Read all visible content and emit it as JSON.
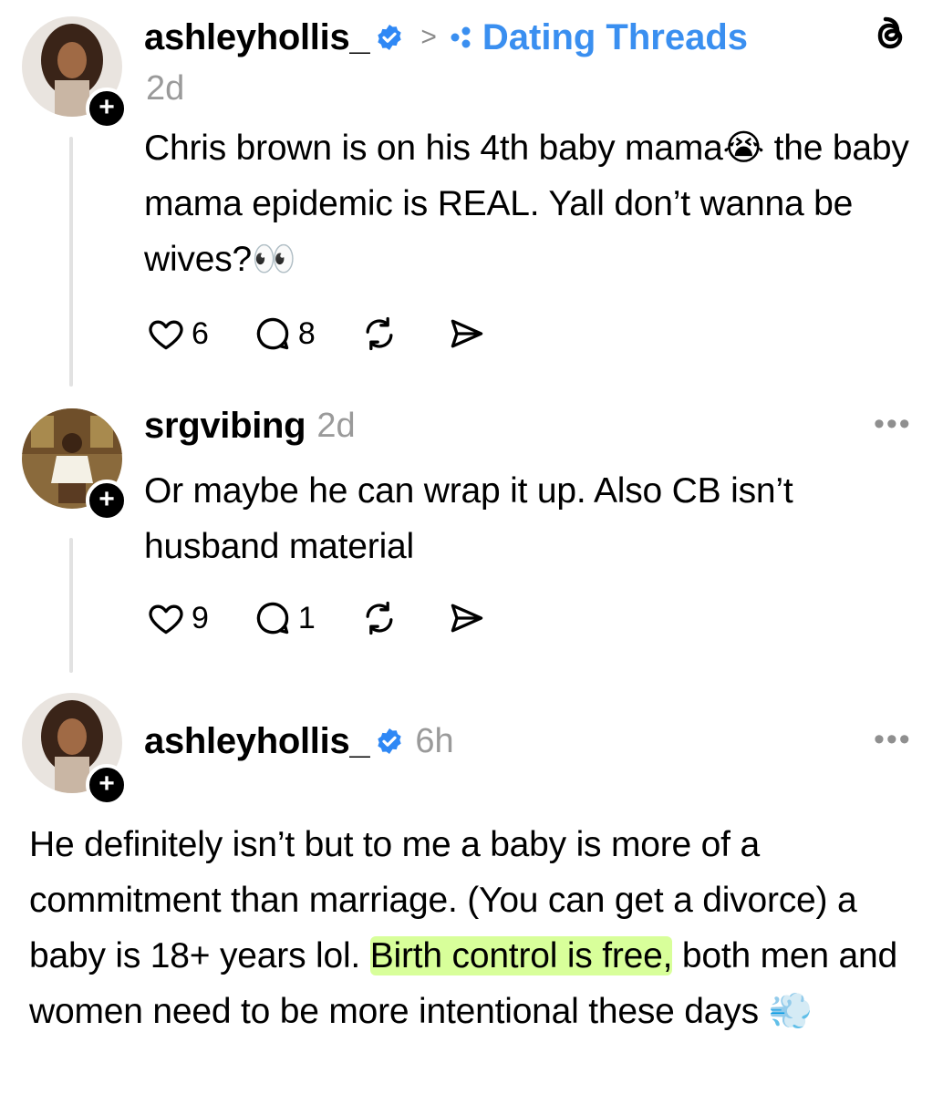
{
  "post": {
    "username": "ashleyhollis_",
    "breadcrumb_sep": ">",
    "community": "Dating Threads",
    "time": "2d",
    "text": "Chris brown is on his 4th baby mama😭 the baby mama epidemic is REAL. Yall don’t wanna be wives?👀",
    "likes": "6",
    "replies": "8"
  },
  "reply1": {
    "username": "srgvibing",
    "time": "2d",
    "text": "Or maybe he can wrap it up. Also CB isn’t husband material",
    "likes": "9",
    "replies": "1"
  },
  "reply2": {
    "username": "ashleyhollis_",
    "time": "6h",
    "text_before": "He definitely isn’t but to me a baby is more of a commitment than marriage. (You can get a divorce) a baby is 18+ years lol. ",
    "text_highlight": "Birth control is free,",
    "text_after": " both men and women need to be more intentional these days 💨"
  },
  "ui": {
    "more_dots": "•••",
    "plus": "+"
  },
  "colors": {
    "link_blue": "#3a8ff0",
    "verified_blue": "#2f88f5",
    "muted": "#9a9a9a",
    "highlight": "#d8ff9a"
  }
}
